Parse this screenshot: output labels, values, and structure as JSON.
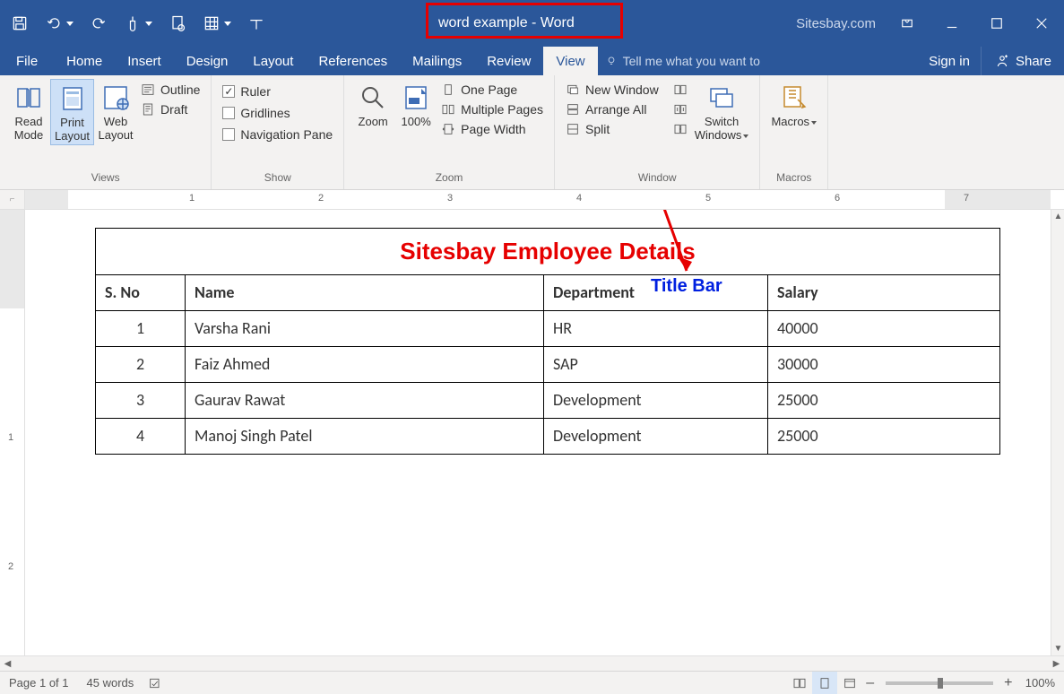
{
  "title": "word example - Word",
  "site_label": "Sitesbay.com",
  "annotation": {
    "label": "Title Bar"
  },
  "tabs": {
    "file": "File",
    "home": "Home",
    "insert": "Insert",
    "design": "Design",
    "layout": "Layout",
    "references": "References",
    "mailings": "Mailings",
    "review": "Review",
    "view": "View",
    "tellme": "Tell me what you want to",
    "signin": "Sign in",
    "share": "Share"
  },
  "ribbon": {
    "views": {
      "label": "Views",
      "read_mode": "Read\nMode",
      "print_layout": "Print\nLayout",
      "web_layout": "Web\nLayout",
      "outline": "Outline",
      "draft": "Draft"
    },
    "show": {
      "label": "Show",
      "ruler": "Ruler",
      "gridlines": "Gridlines",
      "nav_pane": "Navigation Pane"
    },
    "zoom": {
      "label": "Zoom",
      "zoom": "Zoom",
      "hundred": "100%",
      "one_page": "One Page",
      "multi_pages": "Multiple Pages",
      "page_width": "Page Width"
    },
    "window": {
      "label": "Window",
      "new_window": "New Window",
      "arrange_all": "Arrange All",
      "split": "Split",
      "switch": "Switch\nWindows"
    },
    "macros": {
      "label": "Macros",
      "btn": "Macros"
    }
  },
  "document": {
    "title": "Sitesbay Employee Details",
    "headers": [
      "S. No",
      "Name",
      "Department",
      "Salary"
    ],
    "rows": [
      {
        "sno": "1",
        "name": "Varsha Rani",
        "dept": "HR",
        "salary": "40000"
      },
      {
        "sno": "2",
        "name": "Faiz Ahmed",
        "dept": "SAP",
        "salary": "30000"
      },
      {
        "sno": "3",
        "name": "Gaurav Rawat",
        "dept": "Development",
        "salary": "25000"
      },
      {
        "sno": "4",
        "name": "Manoj Singh Patel",
        "dept": "Development",
        "salary": "25000"
      }
    ]
  },
  "statusbar": {
    "page": "Page 1 of 1",
    "words": "45 words",
    "zoom": "100%"
  }
}
